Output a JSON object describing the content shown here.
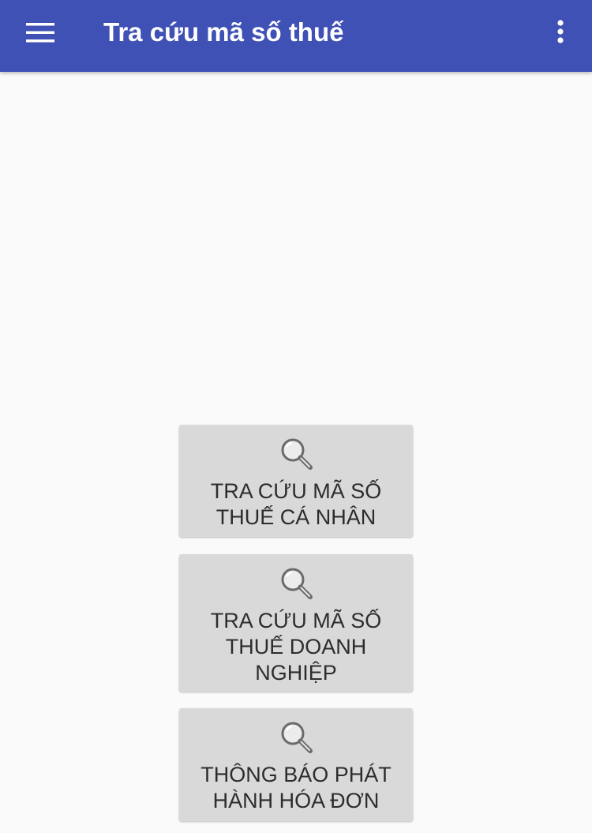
{
  "toolbar": {
    "title": "Tra cứu mã số thuế",
    "menu_icon": "hamburger-menu-icon",
    "overflow_icon": "more-vertical-icon",
    "background_color": "#3f51b5"
  },
  "cards": [
    {
      "icon": "magnifier-icon",
      "label": "TRA CỨU MÃ SỐ THUẾ CÁ NHÂN"
    },
    {
      "icon": "magnifier-icon",
      "label": "TRA CỨU MÃ SỐ THUẾ DOANH NGHIỆP"
    },
    {
      "icon": "magnifier-icon",
      "label": "THÔNG BÁO PHÁT HÀNH HÓA ĐƠN"
    }
  ]
}
